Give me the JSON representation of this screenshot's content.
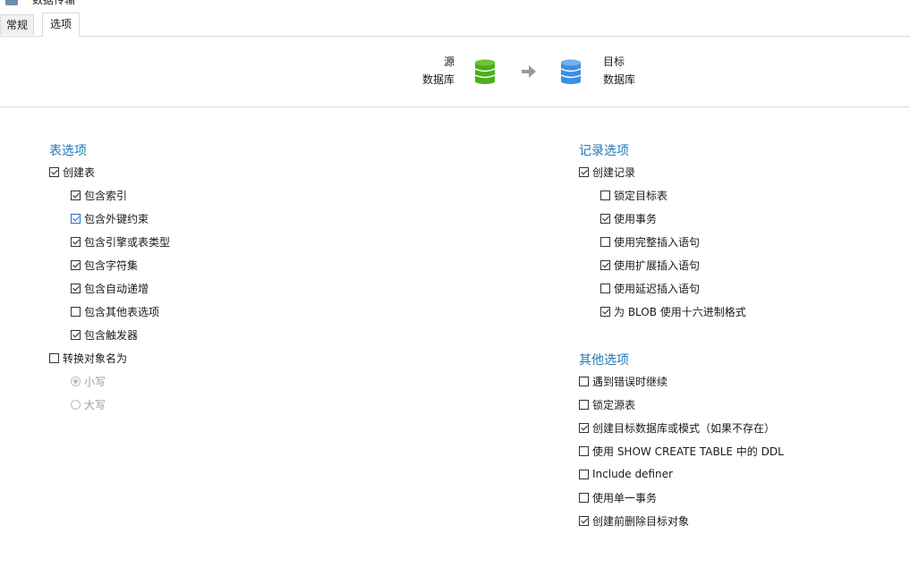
{
  "window": {
    "title": "数据传输"
  },
  "tabs": [
    {
      "label": "常规",
      "active": false
    },
    {
      "label": "选项",
      "active": true
    }
  ],
  "header": {
    "source": {
      "line1": "源",
      "line2": "数据库",
      "icon": "database-green-icon",
      "color": "#4caf1a"
    },
    "arrow_icon": "arrow-right-icon",
    "target": {
      "line1": "目标",
      "line2": "数据库",
      "icon": "database-blue-icon",
      "color": "#3d8fe0"
    }
  },
  "table_options": {
    "title": "表选项",
    "create_table": {
      "label": "创建表",
      "checked": true
    },
    "sub": [
      {
        "label": "包含索引",
        "checked": true
      },
      {
        "label": "包含外键约束",
        "checked": true
      },
      {
        "label": "包含引擎或表类型",
        "checked": true
      },
      {
        "label": "包含字符集",
        "checked": true
      },
      {
        "label": "包含自动递增",
        "checked": true
      },
      {
        "label": "包含其他表选项",
        "checked": false
      },
      {
        "label": "包含触发器",
        "checked": true
      }
    ],
    "convert_names": {
      "label": "转换对象名为",
      "checked": false
    },
    "case": [
      {
        "label": "小写",
        "selected": true
      },
      {
        "label": "大写",
        "selected": false
      }
    ]
  },
  "record_options": {
    "title": "记录选项",
    "create_records": {
      "label": "创建记录",
      "checked": true
    },
    "sub": [
      {
        "label": "锁定目标表",
        "checked": false
      },
      {
        "label": "使用事务",
        "checked": true
      },
      {
        "label": "使用完整插入语句",
        "checked": false
      },
      {
        "label": "使用扩展插入语句",
        "checked": true
      },
      {
        "label": "使用延迟插入语句",
        "checked": false
      },
      {
        "label": "为 BLOB 使用十六进制格式",
        "checked": true
      }
    ]
  },
  "other_options": {
    "title": "其他选项",
    "items": [
      {
        "label": "遇到错误时继续",
        "checked": false
      },
      {
        "label": "锁定源表",
        "checked": false
      },
      {
        "label": "创建目标数据库或模式（如果不存在）",
        "checked": true
      },
      {
        "label": "使用 SHOW CREATE TABLE 中的 DDL",
        "checked": false
      },
      {
        "label": "Include definer",
        "checked": false
      },
      {
        "label": "使用单一事务",
        "checked": false
      },
      {
        "label": "创建前删除目标对象",
        "checked": true
      }
    ]
  }
}
